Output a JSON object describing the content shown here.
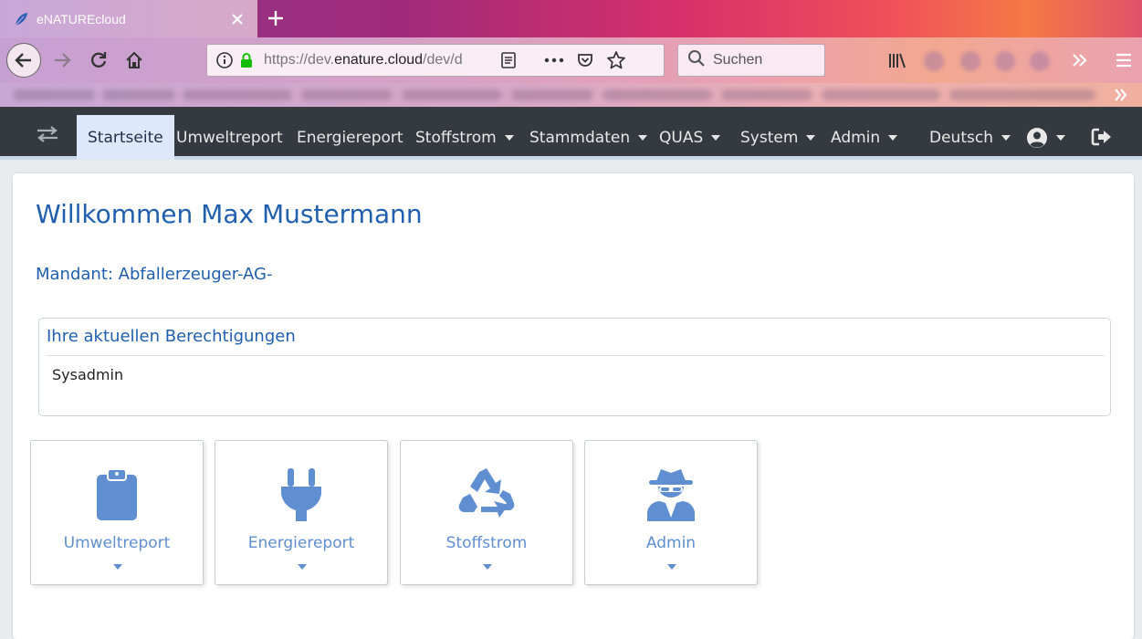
{
  "browser": {
    "tab_title": "eNATUREcloud",
    "url_prefix": "https://dev.",
    "url_host": "enature.cloud",
    "url_path": "/dev/d",
    "search_placeholder": "Suchen"
  },
  "app_nav": {
    "items": [
      {
        "label": "Startseite",
        "active": true
      },
      {
        "label": "Umweltreport"
      },
      {
        "label": "Energiereport"
      },
      {
        "label": "Stoffstrom"
      },
      {
        "label": "Stammdaten"
      },
      {
        "label": "QUAS"
      },
      {
        "label": "System"
      },
      {
        "label": "Admin"
      }
    ],
    "language": "Deutsch"
  },
  "main": {
    "welcome": "Willkommen Max Mustermann",
    "mandant": "Mandant: Abfallerzeuger-AG-",
    "permissions_title": "Ihre aktuellen Berechtigungen",
    "permissions_value": "Sysadmin",
    "tiles": [
      {
        "label": "Umweltreport",
        "icon": "clipboard-icon"
      },
      {
        "label": "Energiereport",
        "icon": "plug-icon"
      },
      {
        "label": "Stoffstrom",
        "icon": "recycle-icon"
      },
      {
        "label": "Admin",
        "icon": "user-secret-icon"
      }
    ]
  },
  "colors": {
    "navbar_bg": "#343a40",
    "active_tab_bg": "#dde9fa",
    "heading_blue": "#1f5fae",
    "tile_icon_blue": "#5f8fd0"
  }
}
